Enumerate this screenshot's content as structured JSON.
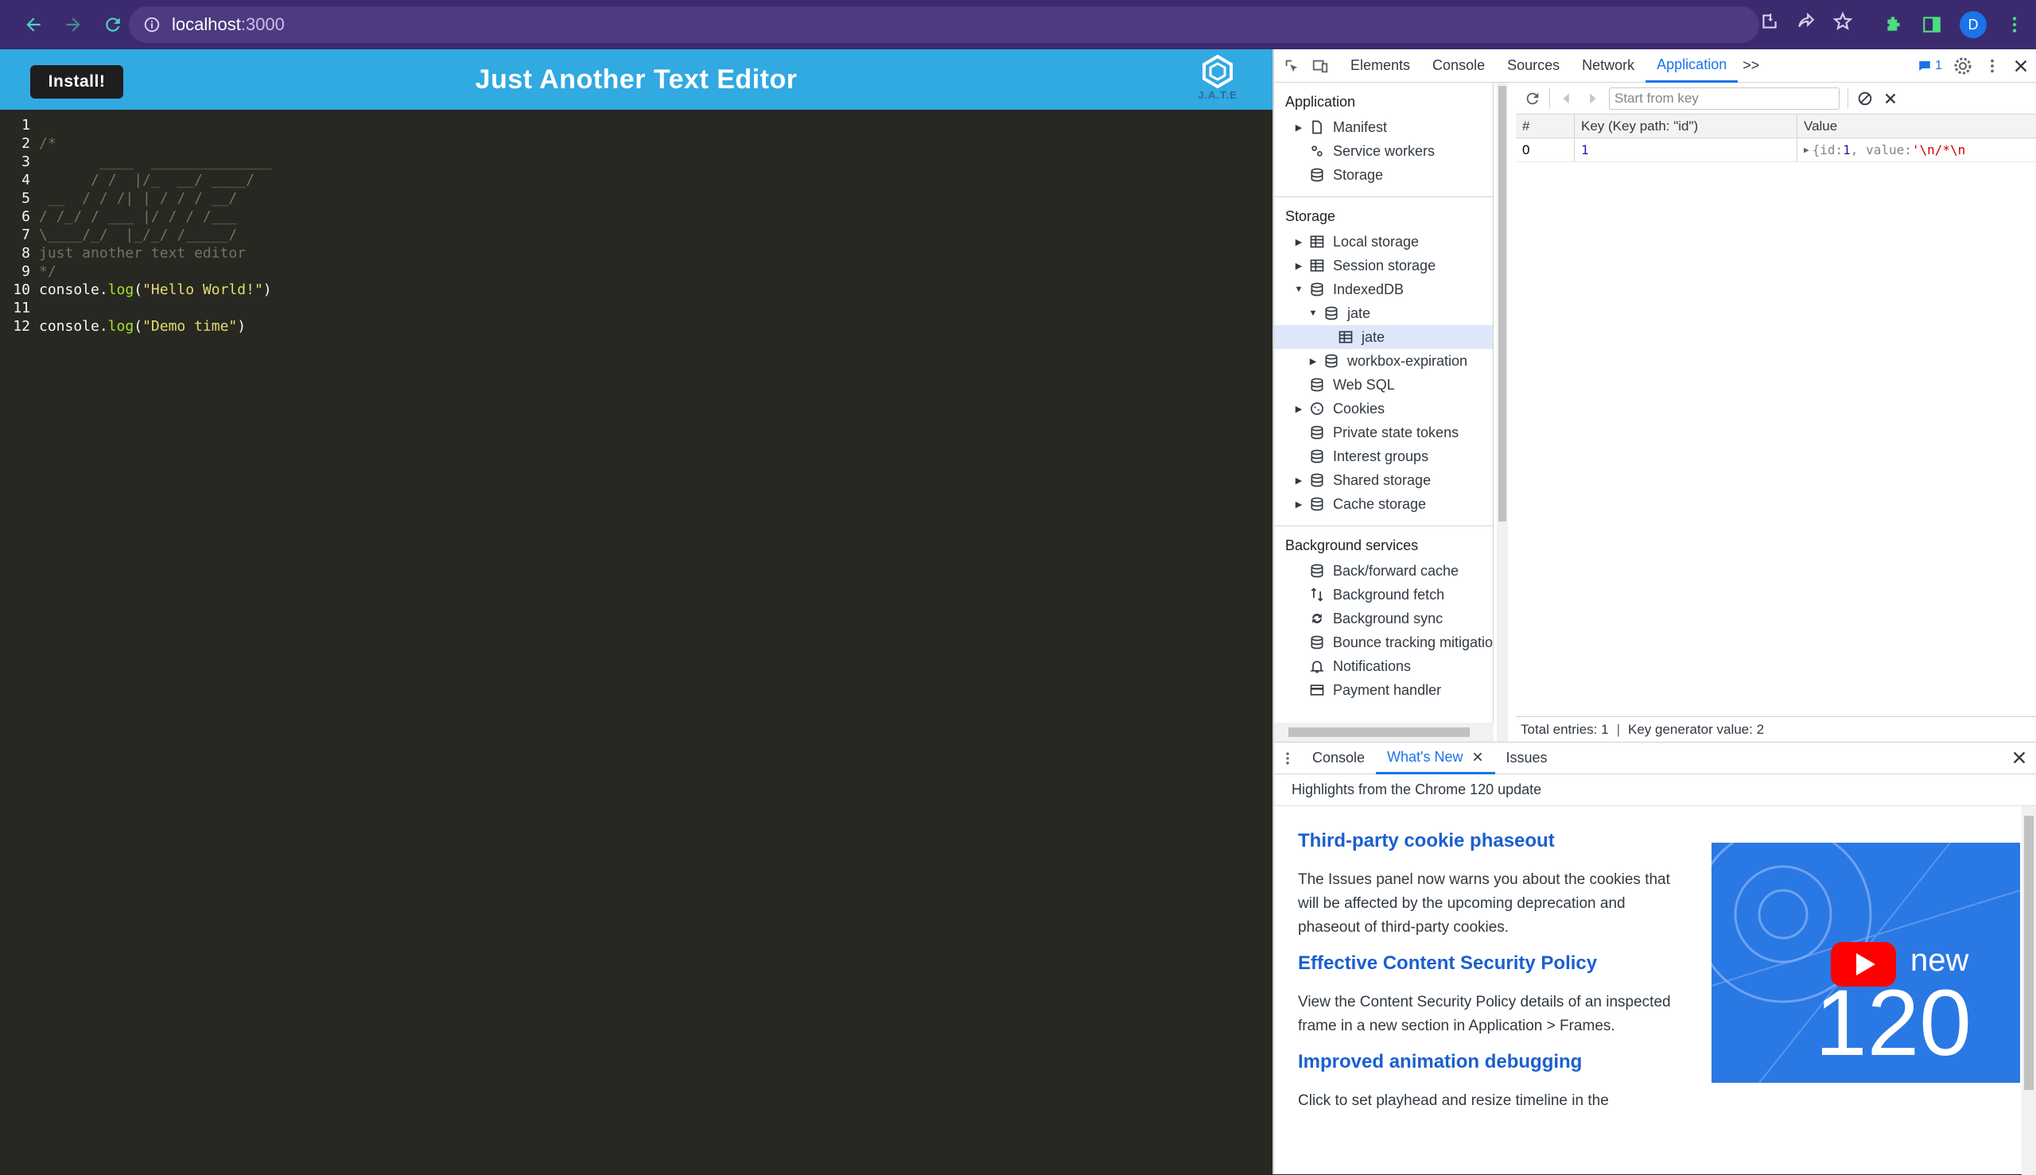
{
  "browser": {
    "url_host": "localhost",
    "url_port": ":3000",
    "avatar_letter": "D"
  },
  "app": {
    "install_label": "Install!",
    "title": "Just Another Text Editor",
    "logo_text": "J.A.T.E",
    "lines": [
      {
        "n": "1",
        "parts": []
      },
      {
        "n": "2",
        "parts": [
          {
            "t": "/*",
            "c": "comment"
          }
        ]
      },
      {
        "n": "3",
        "parts": [
          {
            "t": "       ____  ______________",
            "c": "comment"
          }
        ]
      },
      {
        "n": "4",
        "parts": [
          {
            "t": "      / /  |/_  __/ ____/",
            "c": "comment"
          }
        ]
      },
      {
        "n": "5",
        "parts": [
          {
            "t": " __  / / /| | / / / __/",
            "c": "comment"
          }
        ]
      },
      {
        "n": "6",
        "parts": [
          {
            "t": "/ /_/ / ___ |/ / / /___",
            "c": "comment"
          }
        ]
      },
      {
        "n": "7",
        "parts": [
          {
            "t": "\\____/_/  |_/_/ /_____/",
            "c": "comment"
          }
        ]
      },
      {
        "n": "8",
        "parts": [
          {
            "t": "just another text editor",
            "c": "comment"
          }
        ]
      },
      {
        "n": "9",
        "parts": [
          {
            "t": "*/",
            "c": "comment"
          }
        ]
      },
      {
        "n": "10",
        "parts": [
          {
            "t": "console.",
            "c": ""
          },
          {
            "t": "log",
            "c": "fn"
          },
          {
            "t": "(",
            "c": ""
          },
          {
            "t": "\"Hello World!\"",
            "c": "str"
          },
          {
            "t": ")",
            "c": ""
          }
        ]
      },
      {
        "n": "11",
        "parts": []
      },
      {
        "n": "12",
        "parts": [
          {
            "t": "console.",
            "c": ""
          },
          {
            "t": "log",
            "c": "fn"
          },
          {
            "t": "(",
            "c": ""
          },
          {
            "t": "\"Demo time\"",
            "c": "str"
          },
          {
            "t": ")",
            "c": ""
          }
        ]
      }
    ]
  },
  "devtools": {
    "tabs": [
      "Elements",
      "Console",
      "Sources",
      "Network",
      "Application"
    ],
    "active_tab": "Application",
    "more_label": ">>",
    "message_count": "1",
    "sidebar": {
      "app_section": "Application",
      "app_items": [
        {
          "label": "Manifest",
          "icon": "document-icon",
          "caret": "▶"
        },
        {
          "label": "Service workers",
          "icon": "gears-icon",
          "caret": ""
        },
        {
          "label": "Storage",
          "icon": "database-icon",
          "caret": ""
        }
      ],
      "storage_section": "Storage",
      "storage_items": [
        {
          "label": "Local storage",
          "icon": "table-icon",
          "caret": "▶",
          "indent": 0
        },
        {
          "label": "Session storage",
          "icon": "table-icon",
          "caret": "▶",
          "indent": 0
        },
        {
          "label": "IndexedDB",
          "icon": "database-icon",
          "caret": "▼",
          "indent": 0
        },
        {
          "label": "jate",
          "icon": "database-icon",
          "caret": "▼",
          "indent": 1
        },
        {
          "label": "jate",
          "icon": "table-icon",
          "caret": "",
          "indent": 2,
          "selected": true
        },
        {
          "label": "workbox-expiration",
          "icon": "database-icon",
          "caret": "▶",
          "indent": 1
        },
        {
          "label": "Web SQL",
          "icon": "database-icon",
          "caret": "",
          "indent": 0
        },
        {
          "label": "Cookies",
          "icon": "cookie-icon",
          "caret": "▶",
          "indent": 0
        },
        {
          "label": "Private state tokens",
          "icon": "database-icon",
          "caret": "",
          "indent": 0
        },
        {
          "label": "Interest groups",
          "icon": "database-icon",
          "caret": "",
          "indent": 0
        },
        {
          "label": "Shared storage",
          "icon": "database-icon",
          "caret": "▶",
          "indent": 0
        },
        {
          "label": "Cache storage",
          "icon": "database-icon",
          "caret": "▶",
          "indent": 0
        }
      ],
      "bg_section": "Background services",
      "bg_items": [
        {
          "label": "Back/forward cache",
          "icon": "database-icon"
        },
        {
          "label": "Background fetch",
          "icon": "arrows-icon"
        },
        {
          "label": "Background sync",
          "icon": "sync-icon"
        },
        {
          "label": "Bounce tracking mitigatio",
          "icon": "database-icon"
        },
        {
          "label": "Notifications",
          "icon": "bell-icon"
        },
        {
          "label": "Payment handler",
          "icon": "card-icon"
        }
      ]
    },
    "idb": {
      "key_placeholder": "Start from key",
      "col_index": "#",
      "col_key": "Key (Key path: \"id\")",
      "col_value": "Value",
      "row_index": "0",
      "row_key": "1",
      "row_value_prefix": "{id: ",
      "row_value_id": "1",
      "row_value_mid": ", value: ",
      "row_value_str": "'\\n/*\\n",
      "footer_entries": "Total entries: 1",
      "footer_sep": "|",
      "footer_keygen": "Key generator value: 2"
    },
    "drawer": {
      "tabs": [
        "Console",
        "What's New",
        "Issues"
      ],
      "active_tab": "What's New",
      "header": "Highlights from the Chrome 120 update",
      "items": [
        {
          "title": "Third-party cookie phaseout",
          "body": "The Issues panel now warns you about the cookies that will be affected by the upcoming deprecation and phaseout of third-party cookies."
        },
        {
          "title": "Effective Content Security Policy",
          "body": "View the Content Security Policy details of an inspected frame in a new section in Application > Frames."
        },
        {
          "title": "Improved animation debugging",
          "body": "Click to set playhead and resize timeline in the"
        }
      ],
      "video_word": "new",
      "video_number": "120"
    }
  },
  "colors": {
    "browser_bar": "#3c2a6e",
    "app_header": "#31a9e1",
    "editor_bg": "#272822",
    "devtools_accent": "#1a73e8"
  }
}
